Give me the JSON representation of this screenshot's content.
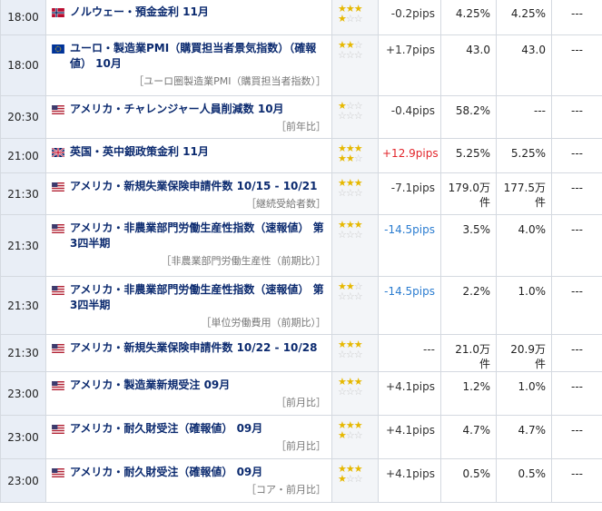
{
  "rows": [
    {
      "time": "18:00",
      "flag": "norway",
      "title": "ノルウェー・預金金利 11月",
      "sub": "",
      "stars": 4,
      "impact": "-0.2pips",
      "impact_type": "neu",
      "prev": "4.25%",
      "forecast": "4.25%",
      "actual": "---",
      "h": 40
    },
    {
      "time": "18:00",
      "flag": "eu",
      "title": "ユーロ・製造業PMI（購買担当者景気指数）（確報値） 10月",
      "sub": "［ユーロ圏製造業PMI（購買担当者指数）］",
      "stars": 2,
      "impact": "+1.7pips",
      "impact_type": "neu",
      "prev": "43.0",
      "forecast": "43.0",
      "actual": "---",
      "h": 67
    },
    {
      "time": "20:30",
      "flag": "usa",
      "title": "アメリカ・チャレンジャー人員削減数 10月",
      "sub": "［前年比］",
      "stars": 1,
      "impact": "-0.4pips",
      "impact_type": "neu",
      "prev": "58.2%",
      "forecast": "---",
      "actual": "---",
      "h": 47
    },
    {
      "time": "21:00",
      "flag": "uk",
      "title": "英国・英中銀政策金利 11月",
      "sub": "",
      "stars": 5,
      "impact": "+12.9pips",
      "impact_type": "pos",
      "prev": "5.25%",
      "forecast": "5.25%",
      "actual": "---",
      "h": 38
    },
    {
      "time": "21:30",
      "flag": "usa",
      "title": "アメリカ・新規失業保険申請件数 10/15 - 10/21",
      "sub": "［継続受給者数］",
      "stars": 3,
      "impact": "-7.1pips",
      "impact_type": "neu",
      "prev": "179.0万件",
      "forecast": "177.5万件",
      "actual": "---",
      "h": 44
    },
    {
      "time": "21:30",
      "flag": "usa",
      "title": "アメリカ・非農業部門労働生産性指数（速報値） 第3四半期",
      "sub": "［非農業部門労働生産性（前期比）］",
      "stars": 3,
      "impact": "-14.5pips",
      "impact_type": "neg",
      "prev": "3.5%",
      "forecast": "4.0%",
      "actual": "---",
      "h": 68
    },
    {
      "time": "21:30",
      "flag": "usa",
      "title": "アメリカ・非農業部門労働生産性指数（速報値） 第3四半期",
      "sub": "［単位労働費用（前期比）］",
      "stars": 2,
      "impact": "-14.5pips",
      "impact_type": "neg",
      "prev": "2.2%",
      "forecast": "1.0%",
      "actual": "---",
      "h": 64
    },
    {
      "time": "21:30",
      "flag": "usa",
      "title": "アメリカ・新規失業保険申請件数 10/22 - 10/28",
      "sub": "",
      "stars": 3,
      "impact": "---",
      "impact_type": "neu",
      "prev": "21.0万件",
      "forecast": "20.9万件",
      "actual": "---",
      "h": 38
    },
    {
      "time": "23:00",
      "flag": "usa",
      "title": "アメリカ・製造業新規受注 09月",
      "sub": "［前月比］",
      "stars": 3,
      "impact": "+4.1pips",
      "impact_type": "neu",
      "prev": "1.2%",
      "forecast": "1.0%",
      "actual": "---",
      "h": 48
    },
    {
      "time": "23:00",
      "flag": "usa",
      "title": "アメリカ・耐久財受注（確報値） 09月",
      "sub": "［前月比］",
      "stars": 4,
      "impact": "+4.1pips",
      "impact_type": "neu",
      "prev": "4.7%",
      "forecast": "4.7%",
      "actual": "---",
      "h": 48
    },
    {
      "time": "23:00",
      "flag": "usa",
      "title": "アメリカ・耐久財受注（確報値） 09月",
      "sub": "［コア・前月比］",
      "stars": 4,
      "impact": "+4.1pips",
      "impact_type": "neu",
      "prev": "0.5%",
      "forecast": "0.5%",
      "actual": "---",
      "h": 48
    }
  ]
}
